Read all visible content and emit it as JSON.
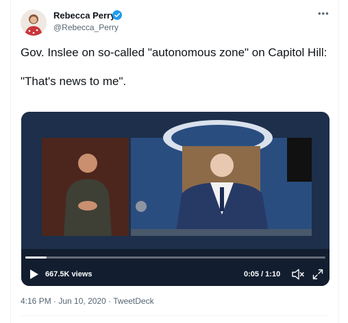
{
  "author": {
    "name": "Rebecca Perry",
    "handle": "@Rebecca_Perry",
    "verified_color": "#1d9bf0"
  },
  "more_icon": "more-horizontal-icon",
  "tweet": {
    "text": "Gov. Inslee on so-called \"autonomous zone\" on Capitol Hill:\n\n\"That's news to me\"."
  },
  "video": {
    "views": "667.5K views",
    "time": "0:05 / 1:10",
    "progress_fraction": 0.07,
    "icons": [
      "play-icon",
      "mute-icon",
      "fullscreen-icon"
    ]
  },
  "meta": {
    "time": "4:16 PM",
    "separator1": " · ",
    "date": "Jun 10, 2020",
    "separator2": " · ",
    "source": "TweetDeck"
  },
  "colors": {
    "text_primary": "#0f1419",
    "text_secondary": "#536471",
    "video_bg": "#223551"
  }
}
